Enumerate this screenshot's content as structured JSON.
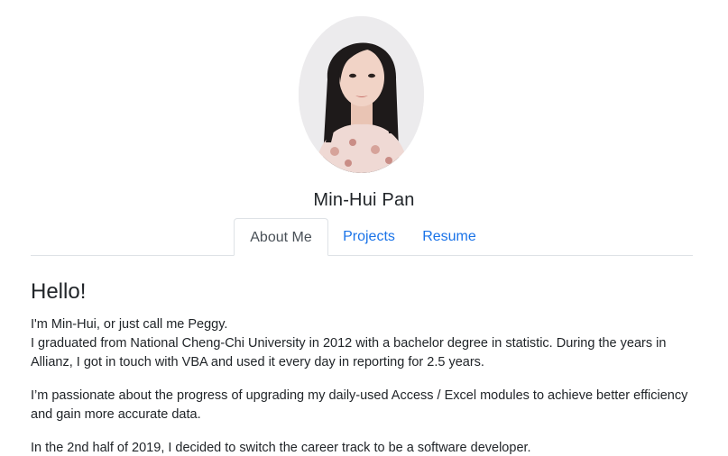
{
  "profile": {
    "name": "Min-Hui Pan"
  },
  "tabs": [
    {
      "label": "About Me",
      "active": true
    },
    {
      "label": "Projects",
      "active": false
    },
    {
      "label": "Resume",
      "active": false
    }
  ],
  "about": {
    "heading": "Hello!",
    "intro_line": "I'm Min-Hui, or just call me Peggy.",
    "paragraph1_rest": "I graduated from National Cheng-Chi University in 2012 with a bachelor degree in statistic. During the years in Allianz, I got in touch with VBA and used it every day in reporting for 2.5 years.",
    "paragraph2": "I’m passionate about the progress of upgrading my daily-used Access / Excel modules to achieve better efficiency and gain more accurate data.",
    "paragraph3": "In the 2nd half of 2019, I decided to switch the career track to be a software developer."
  },
  "colors": {
    "link": "#1a73e8",
    "text": "#212529",
    "active_tab_text": "#495057",
    "border": "#dee2e6"
  }
}
